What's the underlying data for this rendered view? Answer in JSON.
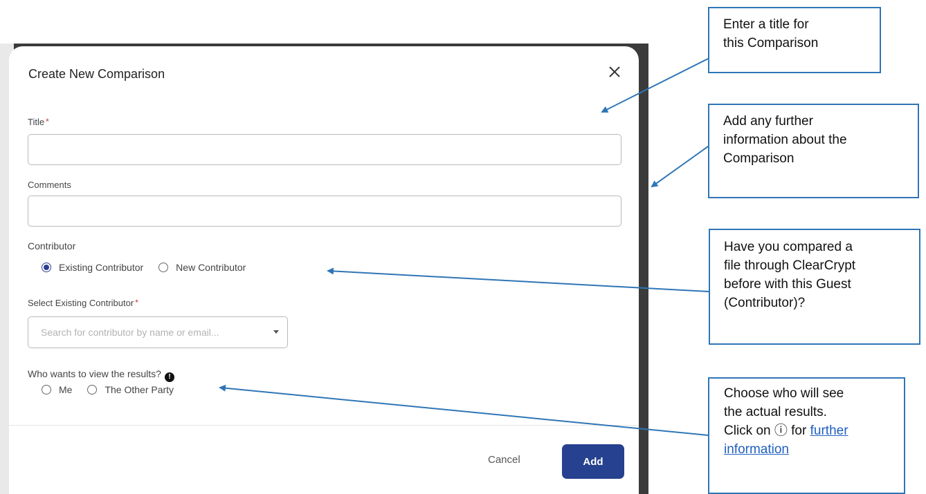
{
  "modal": {
    "title": "Create New Comparison",
    "title_field": {
      "label": "Title",
      "required_mark": "*",
      "value": ""
    },
    "comments_field": {
      "label": "Comments",
      "value": ""
    },
    "contributor": {
      "label": "Contributor",
      "options": [
        {
          "label": "Existing Contributor",
          "checked": true
        },
        {
          "label": "New Contributor",
          "checked": false
        }
      ]
    },
    "select_contributor": {
      "label": "Select Existing Contributor",
      "required_mark": "*",
      "placeholder": "Search for contributor by name or email..."
    },
    "viewer": {
      "label": "Who wants to view the results?",
      "info_glyph": "!",
      "options": [
        {
          "label": "Me",
          "checked": false
        },
        {
          "label": "The Other Party",
          "checked": false
        }
      ]
    },
    "footer": {
      "cancel_label": "Cancel",
      "add_label": "Add"
    }
  },
  "callouts": {
    "title": [
      "Enter a title for",
      "this Comparison"
    ],
    "comments": [
      "Add any further",
      "information about the",
      "Comparison"
    ],
    "contributor": [
      "Have you compared a",
      "file through ClearCrypt",
      "before with this Guest",
      "(Contributor)?"
    ],
    "viewer": {
      "line1": "Choose who will see",
      "line2": "the actual results.",
      "line3_prefix": "Click on",
      "info_symbol": "ⓘ",
      "line3_mid": "for",
      "link_part1": "further",
      "link_part2": "information"
    }
  },
  "colors": {
    "accent": "#25418f",
    "callout_border": "#2e75b6",
    "required": "#d0312d"
  }
}
